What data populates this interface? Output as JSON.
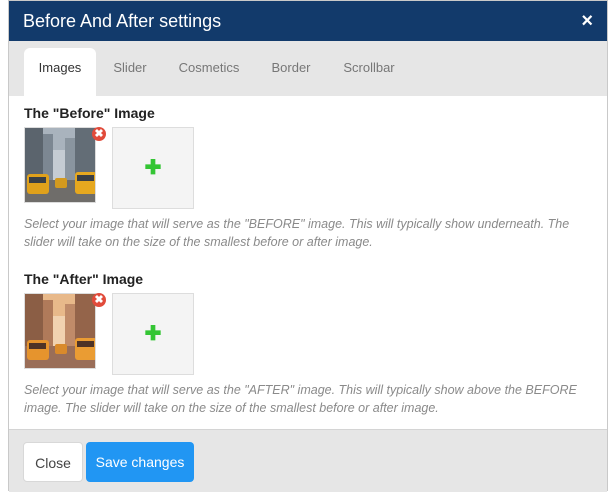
{
  "dialog": {
    "title": "Before And After settings",
    "close_symbol": "×"
  },
  "tabs": [
    {
      "label": "Images",
      "active": true
    },
    {
      "label": "Slider",
      "active": false
    },
    {
      "label": "Cosmetics",
      "active": false
    },
    {
      "label": "Border",
      "active": false
    },
    {
      "label": "Scrollbar",
      "active": false
    }
  ],
  "before": {
    "heading": "The \"Before\" Image",
    "remove_symbol": "✖",
    "add_symbol": "✚",
    "hint": "Select your image that will serve as the \"BEFORE\" image. This will typically show underneath. The slider will take on the size of the smallest before or after image."
  },
  "after": {
    "heading": "The \"After\" Image",
    "remove_symbol": "✖",
    "add_symbol": "✚",
    "hint": "Select your image that will serve as the \"AFTER\" image. This will typically show above the BEFORE image. The slider will take on the size of the smallest before or after image."
  },
  "footer": {
    "close_label": "Close",
    "save_label": "Save changes"
  },
  "colors": {
    "header_bg": "#123a6b",
    "save_button": "#2196f3",
    "remove_icon": "#e14b3b",
    "add_icon": "#34c534"
  }
}
